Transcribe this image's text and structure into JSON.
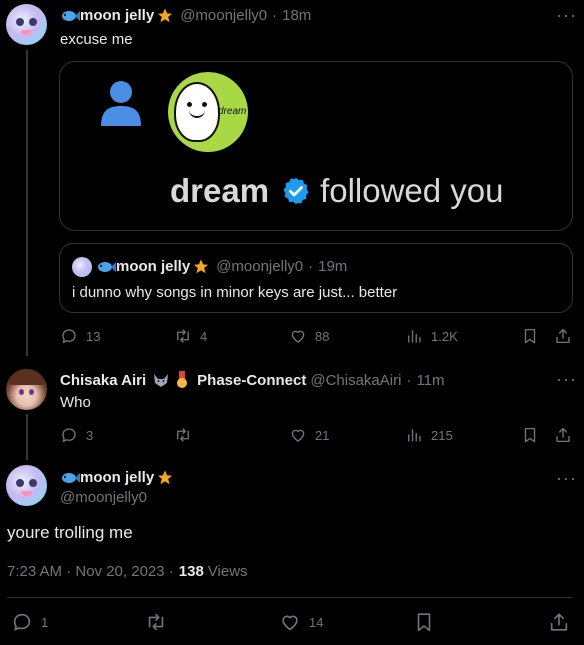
{
  "tweet1": {
    "display_name": "moon jelly",
    "handle": "@moonjelly0",
    "sep": "·",
    "time": "18m",
    "text": "excuse me",
    "image": {
      "avatar_text": "dream",
      "name": "dream",
      "action": "followed you"
    },
    "quote": {
      "display_name": "moon jelly",
      "handle": "@moonjelly0",
      "sep": "·",
      "time": "19m",
      "text": "i dunno why songs in minor keys are just... better"
    },
    "replies": "13",
    "reposts": "4",
    "likes": "88",
    "views": "1.2K"
  },
  "tweet2": {
    "display_name": "Chisaka Airi",
    "affiliation": "Phase-Connect",
    "handle": "@ChisakaAiri",
    "sep": "·",
    "time": "11m",
    "text": "Who",
    "replies": "3",
    "reposts": "",
    "likes": "21",
    "views": "215"
  },
  "main": {
    "display_name": "moon jelly",
    "handle": "@moonjelly0",
    "text": "youre trolling me",
    "timestamp": "7:23 AM · Nov 20, 2023 ·",
    "views_count": "138",
    "views_label": "Views",
    "replies": "1",
    "reposts": "",
    "likes": "14"
  },
  "colors": {
    "accent": "#1d9bf0",
    "dream_green": "#a8d843",
    "star": "#f5a623",
    "muted": "#71767b"
  }
}
